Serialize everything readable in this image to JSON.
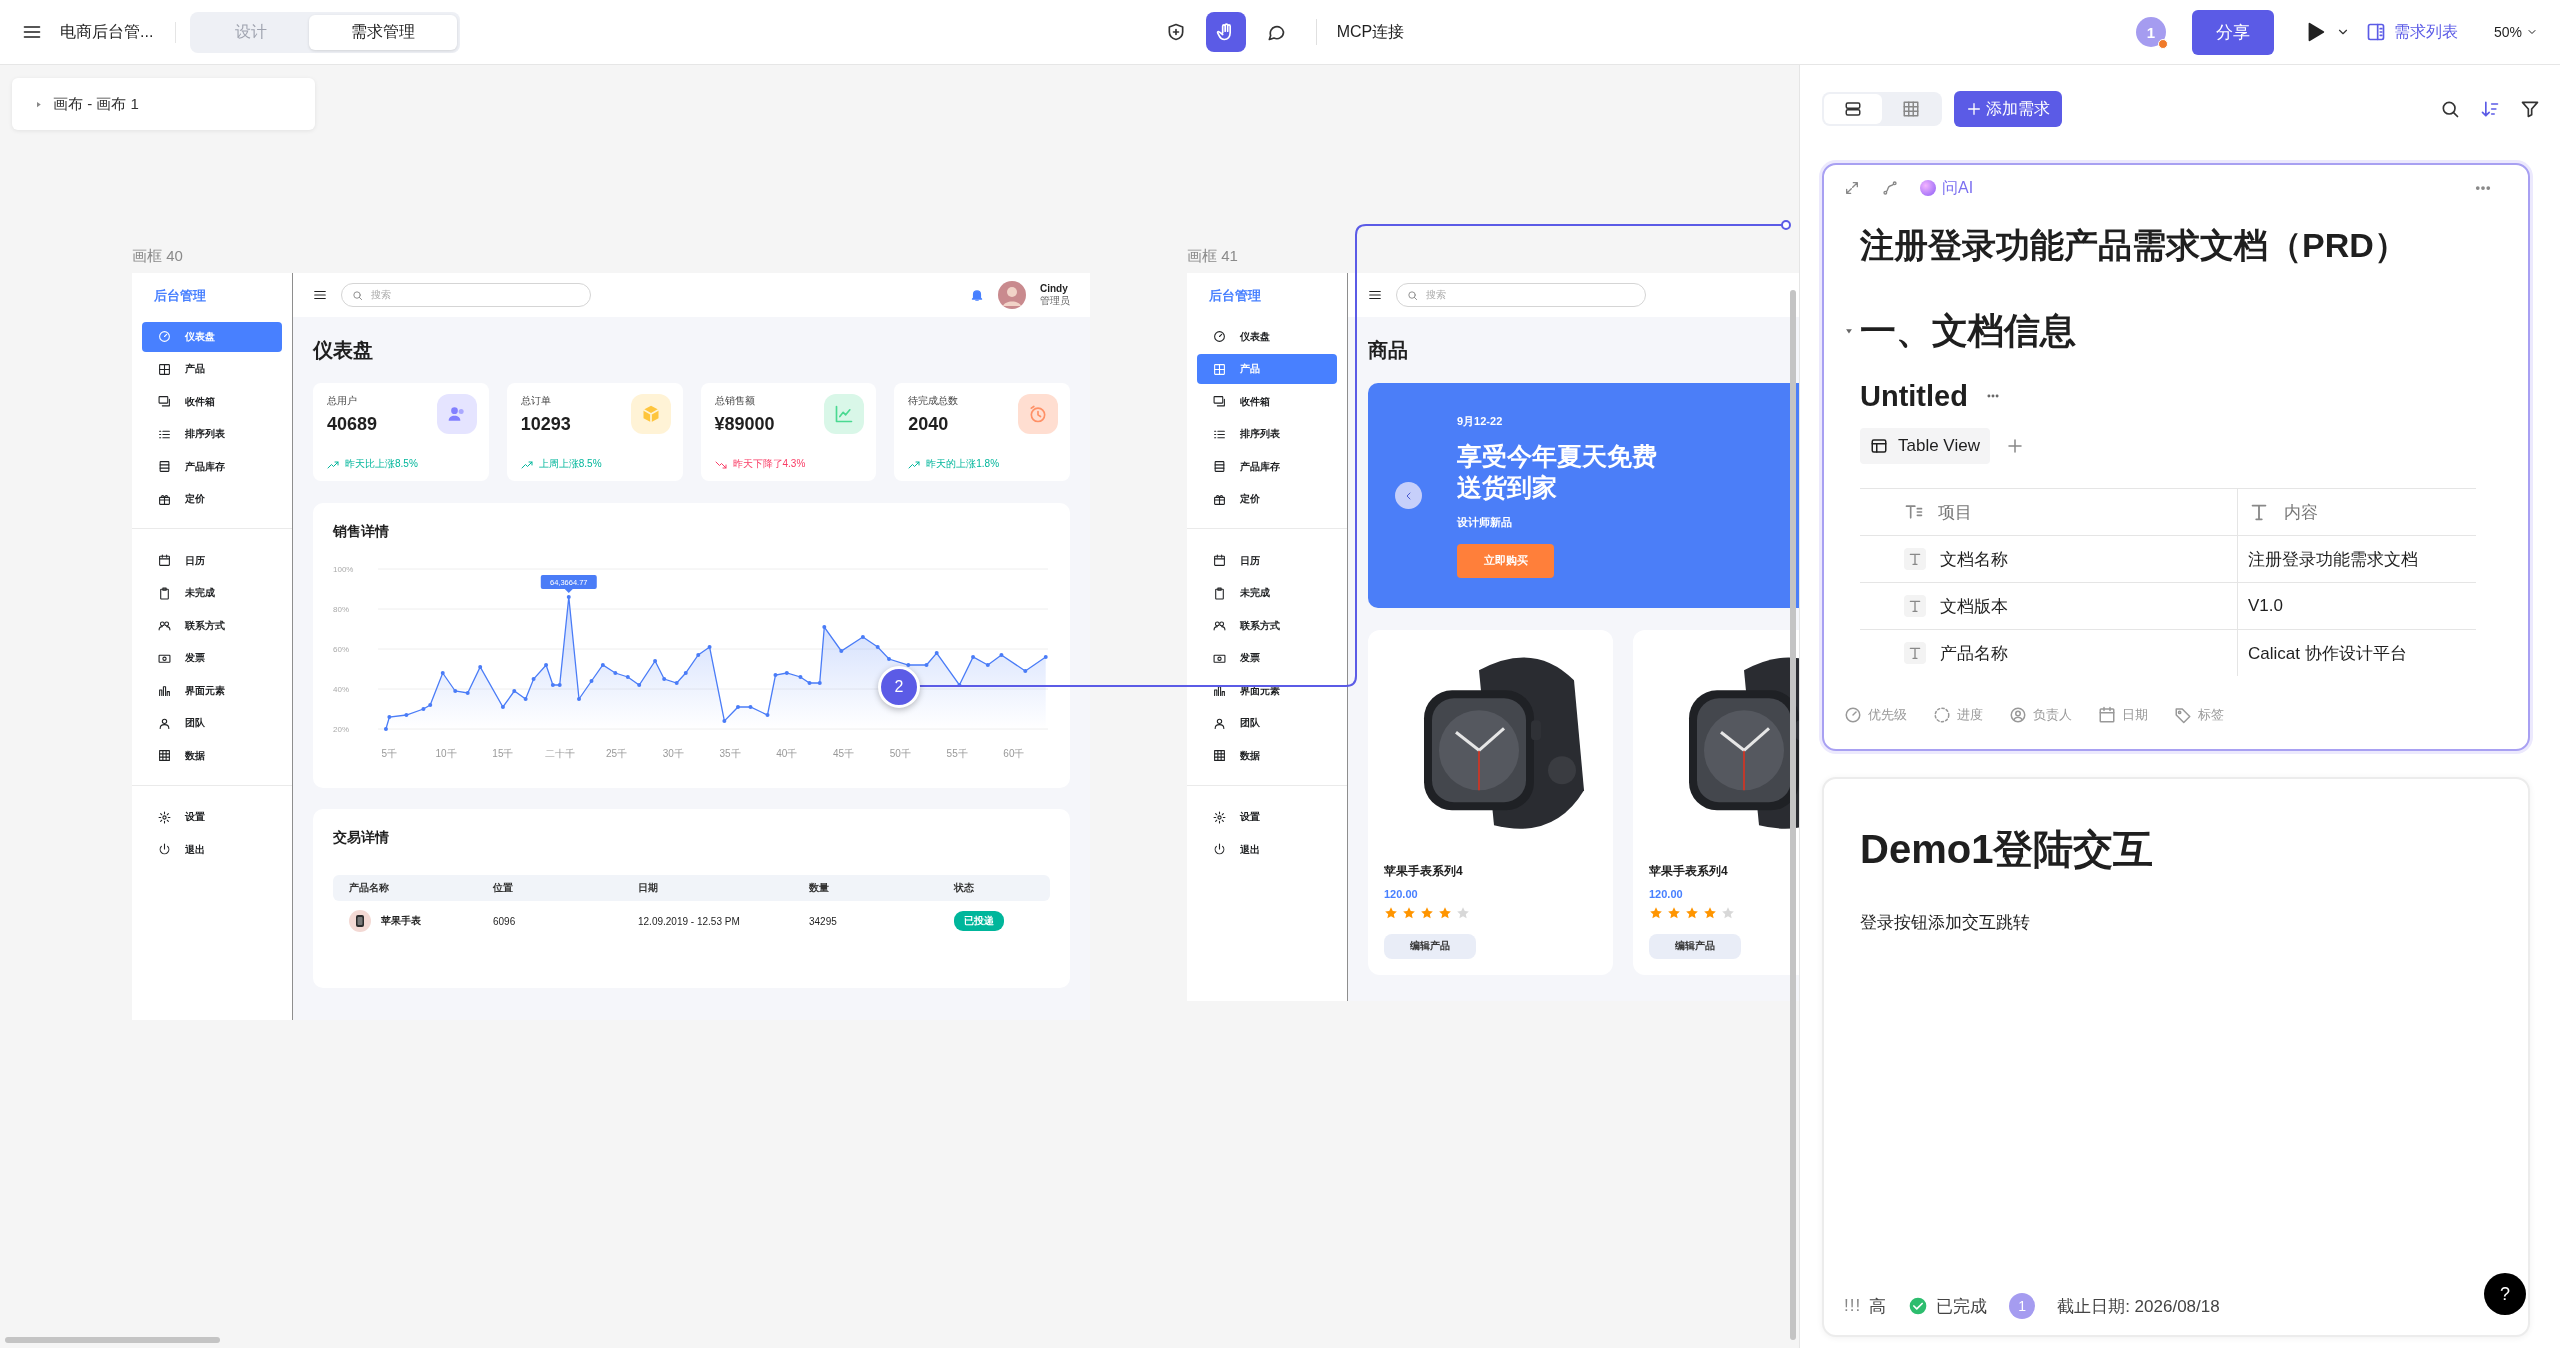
{
  "app_bar": {
    "project_title": "电商后台管...",
    "mode_tabs": [
      {
        "label": "设计",
        "selected": false
      },
      {
        "label": "需求管理",
        "selected": true
      }
    ],
    "tools": [
      {
        "kind": "add",
        "selected": false
      },
      {
        "kind": "hand",
        "selected": true
      },
      {
        "kind": "comment",
        "selected": false
      }
    ],
    "mcp_link": "MCP连接",
    "online_users": "1",
    "share_button": "分享",
    "requirements_button": "需求列表",
    "zoom": "50%"
  },
  "canvas": {
    "breadcrumb": "画布 - 画布 1",
    "comment_pin": {
      "number": "2"
    },
    "frames": [
      {
        "kind": "dashboard",
        "label": "画框 40",
        "brand": "后台管理",
        "search_placeholder": "搜索",
        "user": {
          "name": "Cindy",
          "role": "管理员"
        },
        "nav_groups": [
          {
            "items": [
              {
                "label": "仪表盘",
                "selected": true
              },
              {
                "label": "产品",
                "selected": false
              },
              {
                "label": "收件箱",
                "selected": false
              },
              {
                "label": "排序列表",
                "selected": false
              },
              {
                "label": "产品库存",
                "selected": false
              },
              {
                "label": "定价",
                "selected": false
              }
            ]
          },
          {
            "items": [
              {
                "label": "日历",
                "selected": false
              },
              {
                "label": "未完成",
                "selected": false
              },
              {
                "label": "联系方式",
                "selected": false
              },
              {
                "label": "发票",
                "selected": false
              },
              {
                "label": "界面元素",
                "selected": false
              },
              {
                "label": "团队",
                "selected": false
              },
              {
                "label": "数据",
                "selected": false
              }
            ]
          },
          {
            "items": [
              {
                "label": "设置",
                "selected": false
              },
              {
                "label": "退出",
                "selected": false
              }
            ]
          }
        ],
        "page_title": "仪表盘",
        "stats": [
          {
            "label": "总用户",
            "value": "40689",
            "trend": "昨天比上涨8.5%",
            "trend_up": true
          },
          {
            "label": "总订单",
            "value": "10293",
            "trend": "上周上涨8.5%",
            "trend_up": true
          },
          {
            "label": "总销售额",
            "value": "¥89000",
            "trend": "昨天下降了4.3%",
            "trend_up": false
          },
          {
            "label": "待完成总数",
            "value": "2040",
            "trend": "昨天的上涨1.8%",
            "trend_up": true
          }
        ],
        "sales": {
          "title": "销售详情",
          "tooltip": "64,3664.77",
          "chart_data": {
            "type": "area",
            "grid": true,
            "x": [
              4.7,
              5,
              6.5,
              8,
              8.6,
              9.7,
              10.8,
              11.9,
              13,
              15,
              16,
              17,
              17.7,
              18.8,
              19.4,
              20,
              20.8,
              21.7,
              22.8,
              23.8,
              24.9,
              26,
              27,
              28.4,
              29.2,
              30.3,
              31.1,
              32.2,
              33.2,
              34.5,
              35.7,
              36.8,
              38.3,
              39,
              40,
              41.2,
              42,
              42.9,
              43.3,
              44.8,
              46.7,
              48,
              49,
              50.7,
              52.3,
              53.2,
              55.2,
              56.4,
              57.7,
              58.9,
              61,
              62.8
            ],
            "series": [
              {
                "color": "#4a7cf7",
                "values": [
                  20,
                  26,
                  27,
                  30,
                  32,
                  48,
                  39,
                  38,
                  51,
                  31,
                  39,
                  35,
                  45,
                  52,
                  42,
                  42,
                  86,
                  35,
                  44,
                  52,
                  48,
                  46,
                  42,
                  54,
                  45,
                  43,
                  48,
                  57,
                  61,
                  24,
                  31,
                  31,
                  27,
                  47,
                  48,
                  46,
                  43,
                  43,
                  71,
                  59,
                  66,
                  61,
                  55,
                  52,
                  52,
                  58,
                  42,
                  56,
                  52,
                  57,
                  49,
                  56
                ]
              }
            ],
            "xlim": [
              4,
              63
            ],
            "ylim": [
              20,
              100
            ],
            "xticks": [
              {
                "value": 5,
                "label": "5千"
              },
              {
                "value": 10,
                "label": "10千"
              },
              {
                "value": 15,
                "label": "15千"
              },
              {
                "value": 20,
                "label": "二十千"
              },
              {
                "value": 25,
                "label": "25千"
              },
              {
                "value": 30,
                "label": "30千"
              },
              {
                "value": 35,
                "label": "35千"
              },
              {
                "value": 40,
                "label": "40千"
              },
              {
                "value": 45,
                "label": "45千"
              },
              {
                "value": 50,
                "label": "50千"
              },
              {
                "value": 55,
                "label": "55千"
              },
              {
                "value": 60,
                "label": "60千"
              }
            ],
            "yticks": [
              {
                "value": 20,
                "label": "20%"
              },
              {
                "value": 40,
                "label": "40%"
              },
              {
                "value": 60,
                "label": "60%"
              },
              {
                "value": 80,
                "label": "80%"
              },
              {
                "value": 100,
                "label": "100%"
              }
            ]
          }
        },
        "transactions": {
          "title": "交易详情",
          "columns": [
            "产品名称",
            "位置",
            "日期",
            "数量",
            "状态"
          ],
          "rows": [
            {
              "product": "苹果手表",
              "location": "6096",
              "date": "12.09.2019 - 12.53 PM",
              "quantity": "34295",
              "status": "已投递"
            }
          ]
        }
      },
      {
        "kind": "products",
        "label": "画框 41",
        "brand": "后台管理",
        "search_placeholder": "搜索",
        "nav_groups": [
          {
            "items": [
              {
                "label": "仪表盘",
                "selected": false
              },
              {
                "label": "产品",
                "selected": true
              },
              {
                "label": "收件箱",
                "selected": false
              },
              {
                "label": "排序列表",
                "selected": false
              },
              {
                "label": "产品库存",
                "selected": false
              },
              {
                "label": "定价",
                "selected": false
              }
            ]
          },
          {
            "items": [
              {
                "label": "日历",
                "selected": false
              },
              {
                "label": "未完成",
                "selected": false
              },
              {
                "label": "联系方式",
                "selected": false
              },
              {
                "label": "发票",
                "selected": false
              },
              {
                "label": "界面元素",
                "selected": false
              },
              {
                "label": "团队",
                "selected": false
              },
              {
                "label": "数据",
                "selected": false
              }
            ]
          },
          {
            "items": [
              {
                "label": "设置",
                "selected": false
              },
              {
                "label": "退出",
                "selected": false
              }
            ]
          }
        ],
        "page_title": "商品",
        "banner": {
          "date": "9月12-22",
          "headline": "享受今年夏天免费送货到家",
          "subtitle": "设计师新品",
          "button": "立即购买"
        },
        "products": [
          {
            "name": "苹果手表系列4",
            "price": "120.00",
            "stars": 4,
            "button": "编辑产品"
          },
          {
            "name": "苹果手表系列4",
            "price": "120.00",
            "stars": 4,
            "button": "编辑产品"
          }
        ]
      }
    ]
  },
  "requirements_panel": {
    "view_toggle": [
      {
        "kind": "list",
        "selected": true
      },
      {
        "kind": "table",
        "selected": false
      }
    ],
    "add_button": "添加需求",
    "cards": [
      {
        "kind": "document",
        "selected": true,
        "ask_ai": "问AI",
        "title": "注册登录功能产品需求文档（PRD）",
        "section": {
          "heading": "一、文档信息",
          "expanded": true
        },
        "database": {
          "title": "Untitled",
          "view_tab": "Table View",
          "columns": [
            "项目",
            "内容"
          ],
          "rows": [
            [
              "文档名称",
              "注册登录功能需求文档"
            ],
            [
              "文档版本",
              "V1.0"
            ],
            [
              "产品名称",
              "Calicat 协作设计平台"
            ]
          ]
        },
        "properties": [
          "优先级",
          "进度",
          "负责人",
          "日期",
          "标签"
        ]
      },
      {
        "kind": "demo",
        "selected": false,
        "title": "Demo1登陆交互",
        "body": "登录按钮添加交互跳转",
        "meta": {
          "priority_mark": "!!!",
          "priority": "高",
          "status": "已完成",
          "assignee": "1",
          "due": "截止日期: 2026/08/18"
        }
      }
    ]
  },
  "help_button": "?"
}
